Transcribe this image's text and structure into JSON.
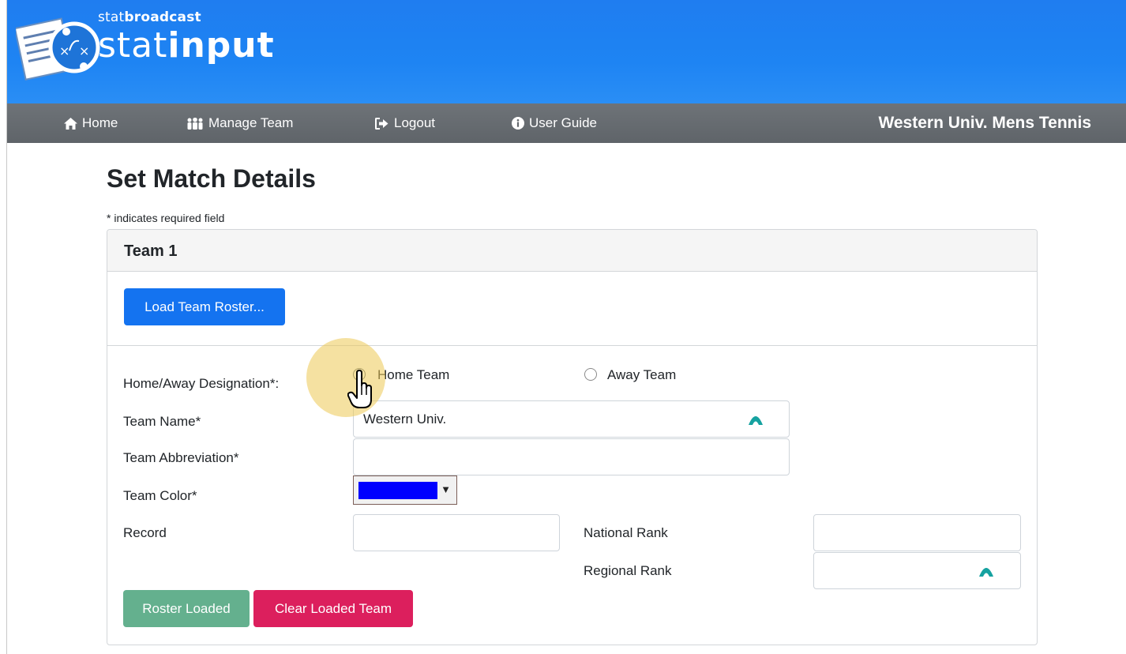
{
  "header": {
    "brand_small_prefix": "stat",
    "brand_small_bold": "broadcast",
    "brand_big_prefix": "stat",
    "brand_big_bold": "input"
  },
  "nav": {
    "items": [
      {
        "label": "Home",
        "icon": "home-icon"
      },
      {
        "label": "Manage Team",
        "icon": "users-icon"
      },
      {
        "label": "Logout",
        "icon": "sign-out-icon"
      },
      {
        "label": "User Guide",
        "icon": "info-circle-icon"
      }
    ],
    "team_name": "Western Univ. Mens Tennis"
  },
  "page": {
    "title": "Set Match Details",
    "required_note": "* indicates required field"
  },
  "team_card": {
    "heading": "Team 1",
    "load_roster_label": "Load Team Roster...",
    "home_away_label": "Home/Away Designation*:",
    "home_option": "Home Team",
    "away_option": "Away Team",
    "selected": "Home Team",
    "team_name_label": "Team Name*",
    "team_name_value": "Western Univ.",
    "abbrev_label": "Team Abbreviation*",
    "abbrev_value": "",
    "color_label": "Team Color*",
    "color_value": "#0000ff",
    "record_label": "Record",
    "record_value": "",
    "national_rank_label": "National Rank",
    "national_rank_value": "",
    "regional_rank_label": "Regional Rank",
    "regional_rank_value": "",
    "roster_loaded_label": "Roster Loaded",
    "clear_team_label": "Clear Loaded Team"
  },
  "colors": {
    "header_blue": "#1e84f3",
    "nav_gray": "#63686d",
    "primary": "#1473f0",
    "success": "#64b08e",
    "danger": "#dc1f5d"
  }
}
